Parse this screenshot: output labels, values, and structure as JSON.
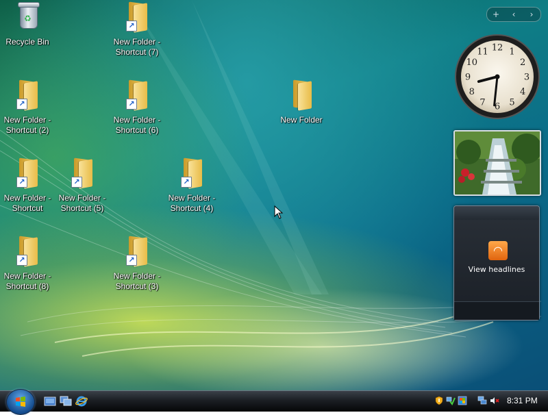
{
  "desktop": {
    "icons": [
      {
        "label": "Recycle Bin",
        "type": "recycle-bin"
      },
      {
        "label": "New Folder - Shortcut (7)",
        "type": "folder-shortcut"
      },
      {
        "label": "New Folder - Shortcut (2)",
        "type": "folder-shortcut"
      },
      {
        "label": "New Folder - Shortcut (6)",
        "type": "folder-shortcut"
      },
      {
        "label": "New Folder",
        "type": "folder"
      },
      {
        "label": "New Folder - Shortcut",
        "type": "folder-shortcut"
      },
      {
        "label": "New Folder - Shortcut (5)",
        "type": "folder-shortcut"
      },
      {
        "label": "New Folder - Shortcut (4)",
        "type": "folder-shortcut"
      },
      {
        "label": "New Folder - Shortcut (8)",
        "type": "folder-shortcut"
      },
      {
        "label": "New Folder - Shortcut (3)",
        "type": "folder-shortcut"
      }
    ]
  },
  "sidebar": {
    "controls": {
      "add": "+",
      "prev": "‹",
      "next": "›"
    },
    "clock": {
      "hour": 8,
      "minute": 31,
      "numerals": [
        "12",
        "1",
        "2",
        "3",
        "4",
        "5",
        "6",
        "7",
        "8",
        "9",
        "10",
        "11"
      ]
    },
    "feed": {
      "label": "View headlines",
      "icon": "rss-feed-icon"
    }
  },
  "taskbar": {
    "quick_launch": [
      "show-desktop-icon",
      "switch-windows-icon",
      "internet-explorer-icon"
    ],
    "tray_icons": [
      "security-shield-icon",
      "network-icon",
      "windows-update-icon",
      "monitor-network-icon",
      "volume-muted-icon"
    ],
    "clock": "8:31 PM"
  },
  "colors": {
    "accent_blue": "#1f5fc6",
    "folder_yellow": "#f2cd62",
    "taskbar_dark": "#1b1f24",
    "feed_orange": "#e0640e"
  }
}
